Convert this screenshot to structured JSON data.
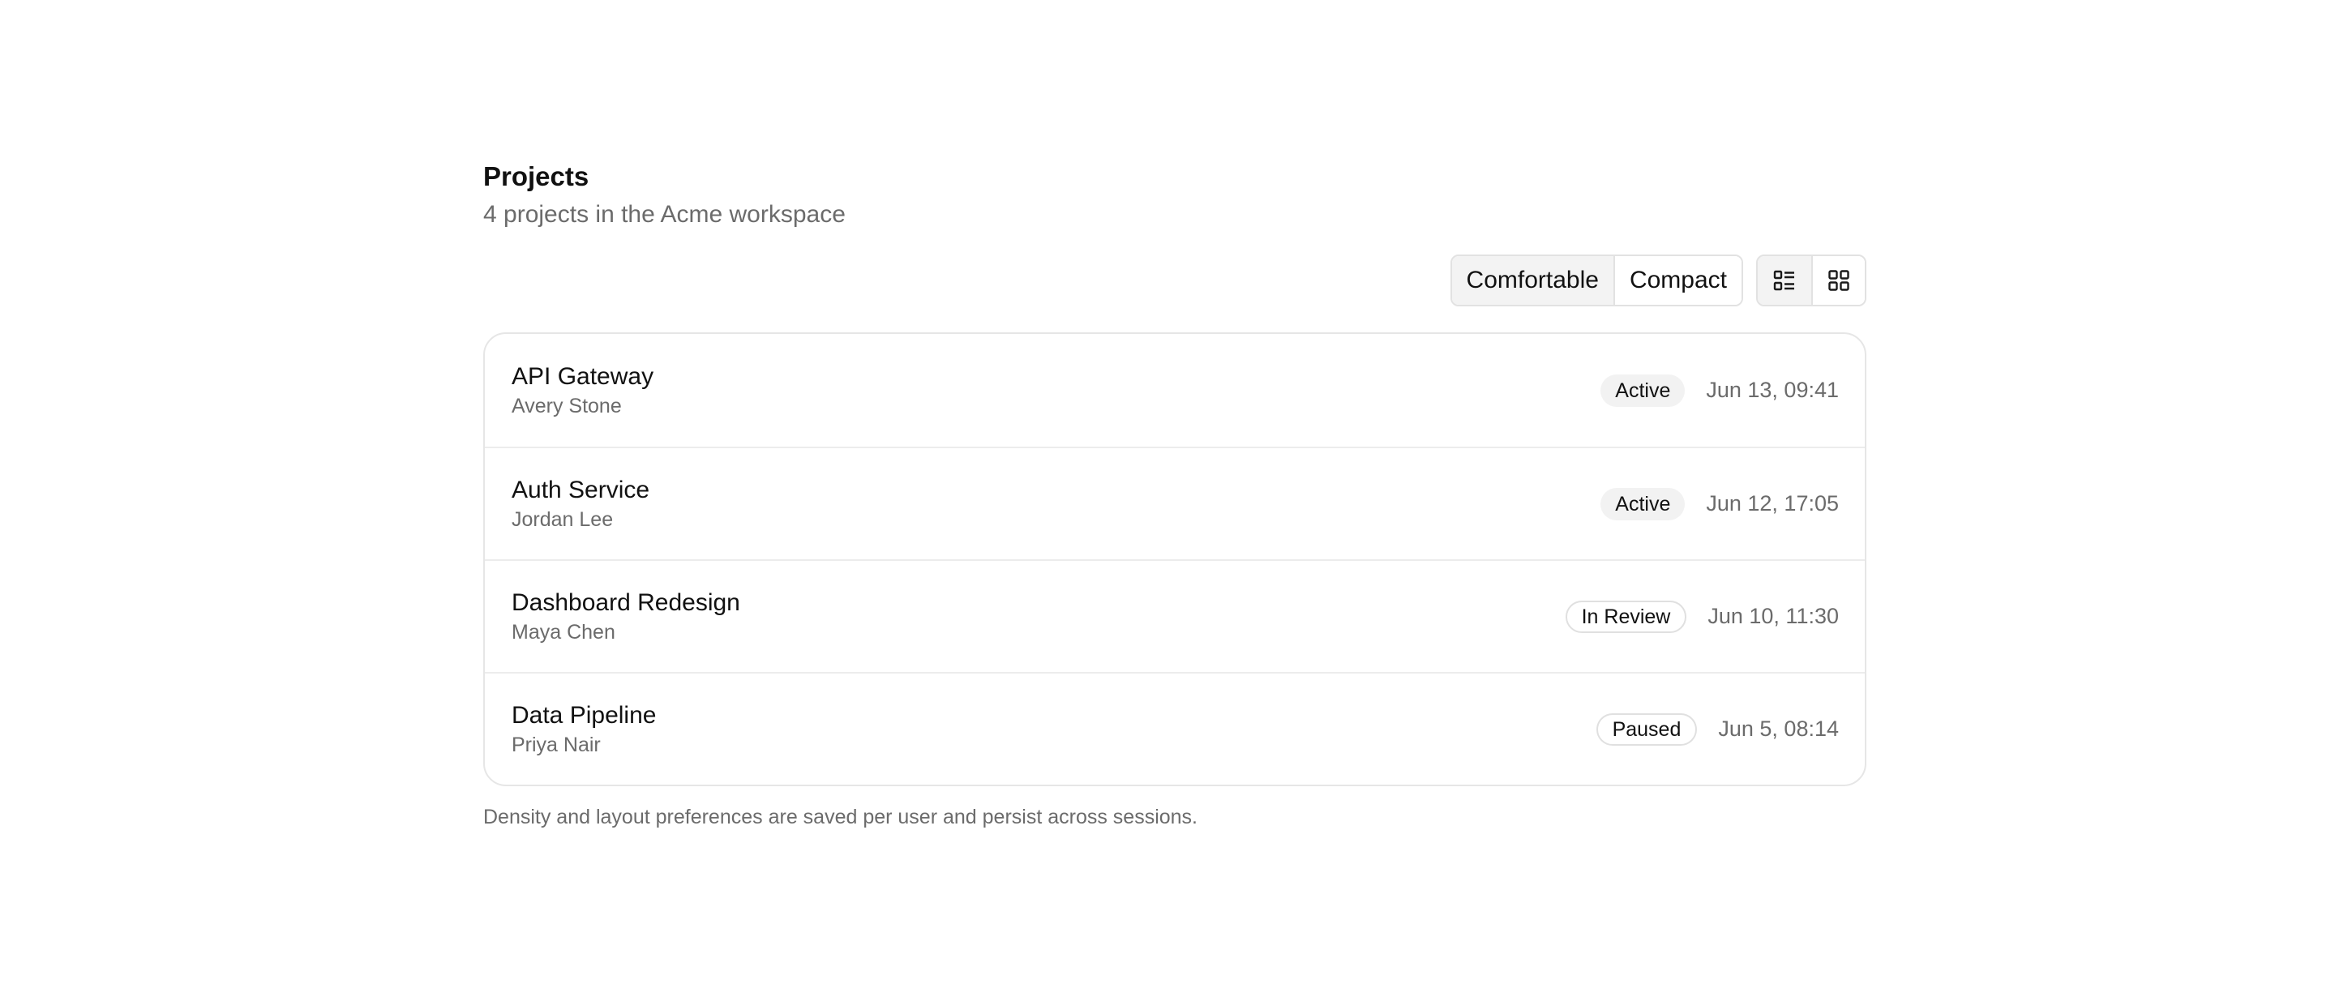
{
  "header": {
    "title": "Projects",
    "subtitle": "4 projects in the Acme workspace"
  },
  "toolbar": {
    "density": {
      "options": [
        "Comfortable",
        "Compact"
      ],
      "selected": "Comfortable"
    },
    "layout": {
      "options": [
        {
          "icon": "list-view-icon",
          "label": "List view"
        },
        {
          "icon": "grid-view-icon",
          "label": "Grid view"
        }
      ],
      "selected": "list"
    }
  },
  "projects": [
    {
      "name": "API Gateway",
      "owner": "Avery Stone",
      "status": "Active",
      "updated": "Jun 13, 09:41"
    },
    {
      "name": "Auth Service",
      "owner": "Jordan Lee",
      "status": "Active",
      "updated": "Jun 12, 17:05"
    },
    {
      "name": "Dashboard Redesign",
      "owner": "Maya Chen",
      "status": "In Review",
      "updated": "Jun 10, 11:30"
    },
    {
      "name": "Data Pipeline",
      "owner": "Priya Nair",
      "status": "Paused",
      "updated": "Jun 5, 08:14"
    }
  ],
  "footnote": "Density and layout preferences are saved per user and persist across sessions.",
  "colors": {
    "text": "#111111",
    "muted": "#6b6b6b",
    "border": "#e6e6e6",
    "badge_bg": "#f2f2f2",
    "selected_bg": "#f3f3f3"
  }
}
